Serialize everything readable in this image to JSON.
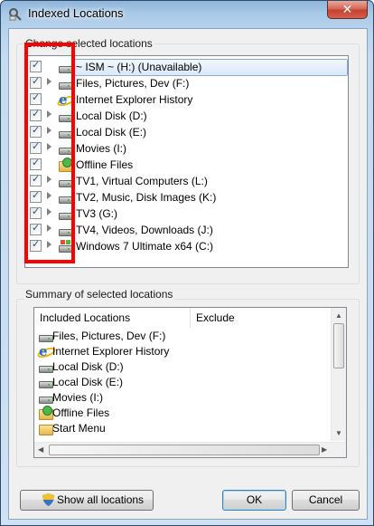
{
  "window": {
    "title": "Indexed Locations",
    "close_label": "✕"
  },
  "change_group": {
    "label": "Change selected locations",
    "items": [
      {
        "label": "~ ISM ~  (H:) (Unavailable)",
        "icon": "drive-icon",
        "checked": true,
        "expandable": false,
        "selected": true
      },
      {
        "label": "Files, Pictures, Dev (F:)",
        "icon": "drive-icon",
        "checked": true,
        "expandable": true
      },
      {
        "label": "Internet Explorer History",
        "icon": "ie-icon",
        "checked": true,
        "expandable": false
      },
      {
        "label": "Local Disk (D:)",
        "icon": "drive-icon",
        "checked": true,
        "expandable": true
      },
      {
        "label": "Local Disk (E:)",
        "icon": "drive-icon",
        "checked": true,
        "expandable": true
      },
      {
        "label": "Movies (I:)",
        "icon": "drive-icon",
        "checked": true,
        "expandable": true
      },
      {
        "label": "Offline Files",
        "icon": "offline-files-icon",
        "checked": true,
        "expandable": false
      },
      {
        "label": "TV1, Virtual Computers (L:)",
        "icon": "drive-icon",
        "checked": true,
        "expandable": true
      },
      {
        "label": "TV2, Music, Disk Images (K:)",
        "icon": "drive-icon",
        "checked": true,
        "expandable": true
      },
      {
        "label": "TV3 (G:)",
        "icon": "drive-icon",
        "checked": true,
        "expandable": true
      },
      {
        "label": "TV4, Videos, Downloads (J:)",
        "icon": "drive-icon",
        "checked": true,
        "expandable": true
      },
      {
        "label": "Windows 7 Ultimate x64 (C:)",
        "icon": "windows-drive-icon",
        "checked": true,
        "expandable": true
      }
    ]
  },
  "summary_group": {
    "label": "Summary of selected locations",
    "columns": [
      "Included Locations",
      "Exclude"
    ],
    "rows": [
      {
        "location": "Files, Pictures, Dev (F:)",
        "icon": "drive-icon",
        "exclude": ""
      },
      {
        "location": "Internet Explorer History",
        "icon": "ie-icon",
        "exclude": ""
      },
      {
        "location": "Local Disk (D:)",
        "icon": "drive-icon",
        "exclude": ""
      },
      {
        "location": "Local Disk (E:)",
        "icon": "drive-icon",
        "exclude": ""
      },
      {
        "location": "Movies (I:)",
        "icon": "drive-icon",
        "exclude": ""
      },
      {
        "location": "Offline Files",
        "icon": "offline-files-icon",
        "exclude": ""
      },
      {
        "location": "Start Menu",
        "icon": "folder-icon",
        "exclude": ""
      }
    ]
  },
  "buttons": {
    "show_all": "Show all locations",
    "ok": "OK",
    "cancel": "Cancel"
  },
  "colors": {
    "annotation": "#ff0000",
    "selection": "#dbe8f8",
    "title_bar": "#b6d2ec"
  }
}
